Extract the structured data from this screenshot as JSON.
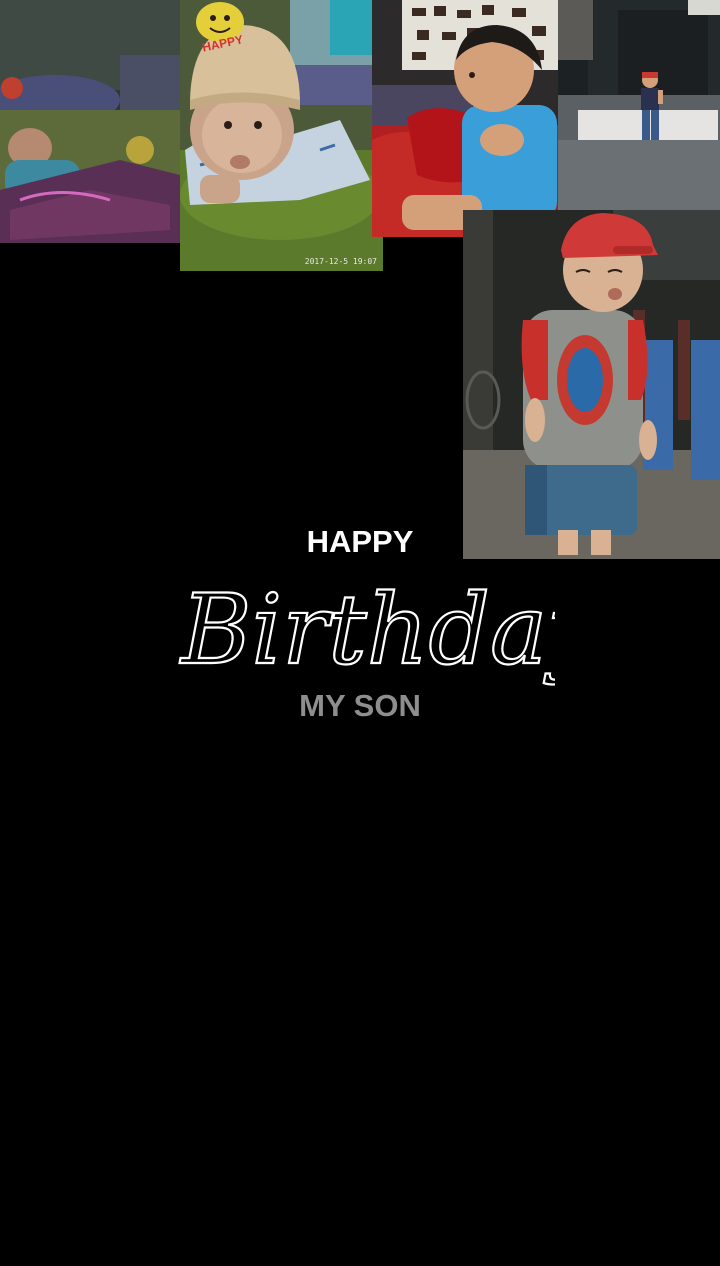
{
  "photos": [
    {
      "subject": "baby lying on floral blanket"
    },
    {
      "subject": "baby in knit HAPPY hat on green sheet",
      "stamp": "2017-12-5 19:07",
      "hat_text": "HAPPY"
    },
    {
      "subject": "toddler holding red pillow beside animal poster"
    },
    {
      "subject": "toddler standing on stage"
    },
    {
      "subject": "boy in red cap blowing a kiss"
    }
  ],
  "greeting": {
    "line1": "HAPPY",
    "line2": "Birthday",
    "line3": "MY SON"
  },
  "colors": {
    "background": "#000000",
    "title_main": "#ffffff",
    "title_sub": "#8e8e8e"
  }
}
